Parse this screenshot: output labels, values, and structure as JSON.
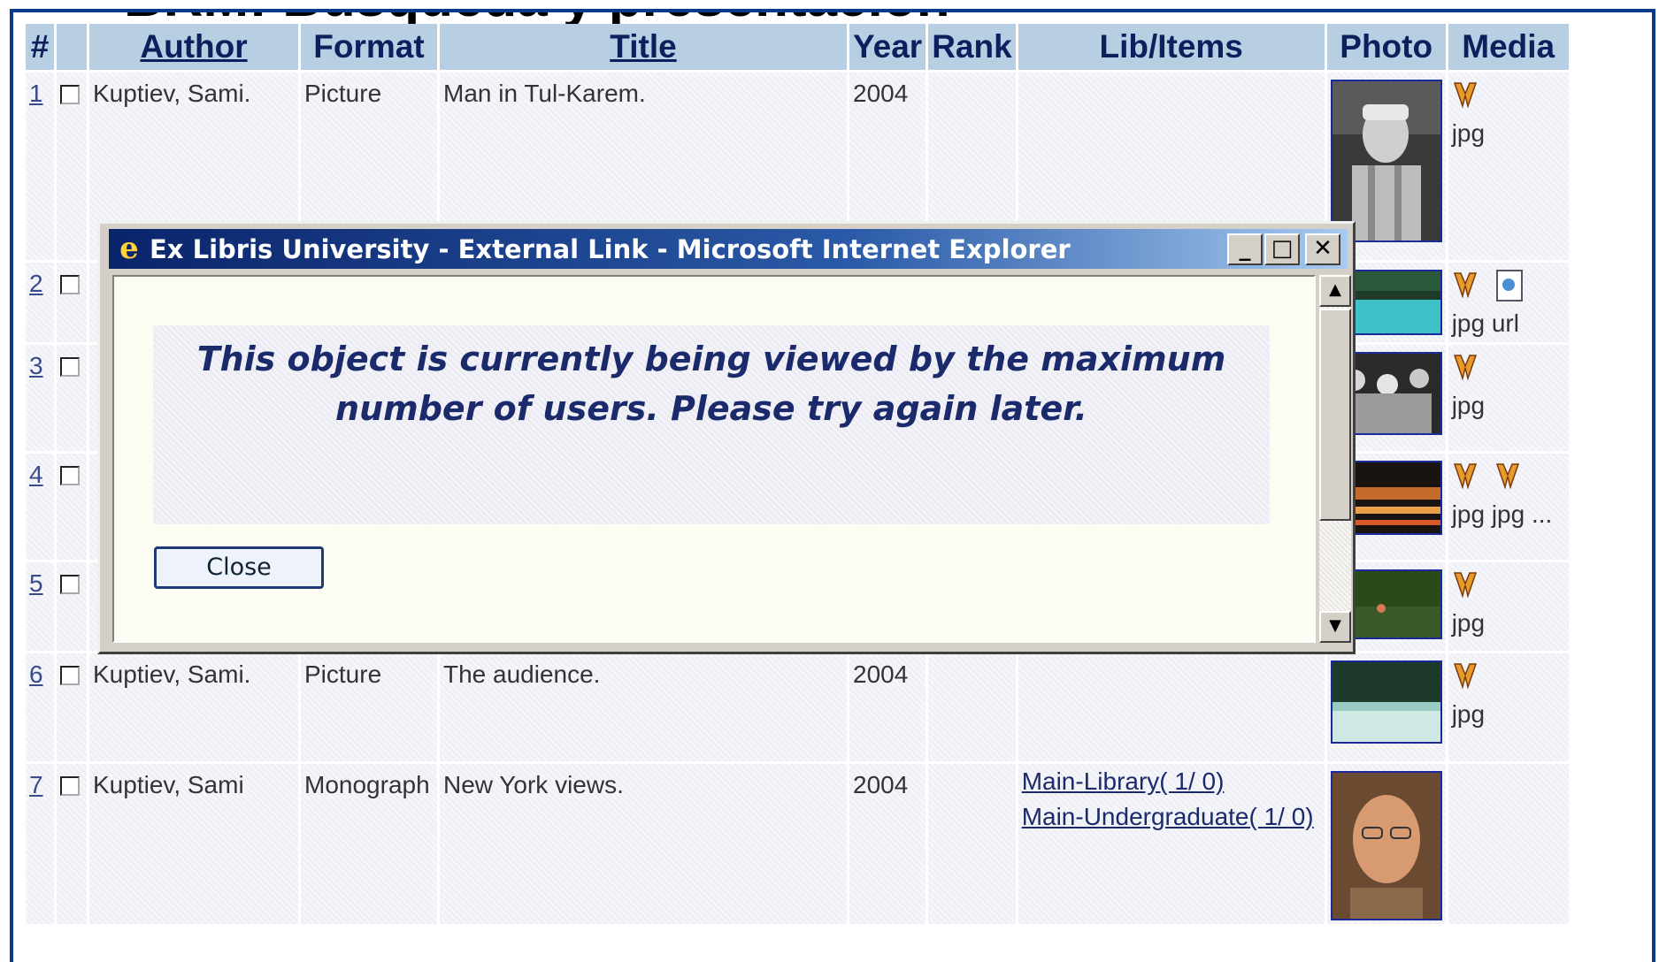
{
  "slide_title": "BRM: Búsqueda y presentación",
  "table": {
    "headers": {
      "num": "#",
      "author": "Author",
      "format": "Format",
      "title": "Title",
      "year": "Year",
      "rank": "Rank",
      "lib": "Lib/Items",
      "photo": "Photo",
      "media": "Media"
    },
    "rows": [
      {
        "num": "1",
        "author": "Kuptiev, Sami.",
        "format": "Picture",
        "title": "Man in Tul-Karem.",
        "year": "2004",
        "lib": [],
        "media_labels": "jpg"
      },
      {
        "num": "2",
        "author": "",
        "format": "",
        "title": "",
        "year": "",
        "lib": [],
        "media_labels": "jpg url"
      },
      {
        "num": "3",
        "author": "",
        "format": "",
        "title": "",
        "year": "",
        "lib": [],
        "media_labels": "jpg"
      },
      {
        "num": "4",
        "author": "",
        "format": "",
        "title": "",
        "year": "",
        "lib": [],
        "media_labels": "jpg jpg ..."
      },
      {
        "num": "5",
        "author": "",
        "format": "",
        "title": "",
        "year": "",
        "lib": [],
        "media_labels": "jpg"
      },
      {
        "num": "6",
        "author": "Kuptiev, Sami.",
        "format": "Picture",
        "title": "The audience.",
        "year": "2004",
        "lib": [],
        "media_labels": "jpg"
      },
      {
        "num": "7",
        "author": "Kuptiev, Sami",
        "format": "Monograph",
        "title": "New York views.",
        "year": "2004",
        "lib": [
          "Main-Library( 1/ 0)",
          "Main-Undergraduate( 1/ 0)"
        ],
        "media_labels": ""
      }
    ]
  },
  "dialog": {
    "title": "Ex Libris University - External Link - Microsoft Internet Explorer",
    "message": "This object is currently being viewed by the maximum number of users. Please try again later.",
    "close_label": "Close",
    "minimize_glyph": "_",
    "maximize_glyph": "□",
    "close_glyph": "✕"
  },
  "colors": {
    "frame": "#0a3a8a",
    "header_bg": "#b8cfe3",
    "header_text": "#0d1f5c",
    "titlebar_start": "#0a246a",
    "titlebar_end": "#a6caf0"
  }
}
